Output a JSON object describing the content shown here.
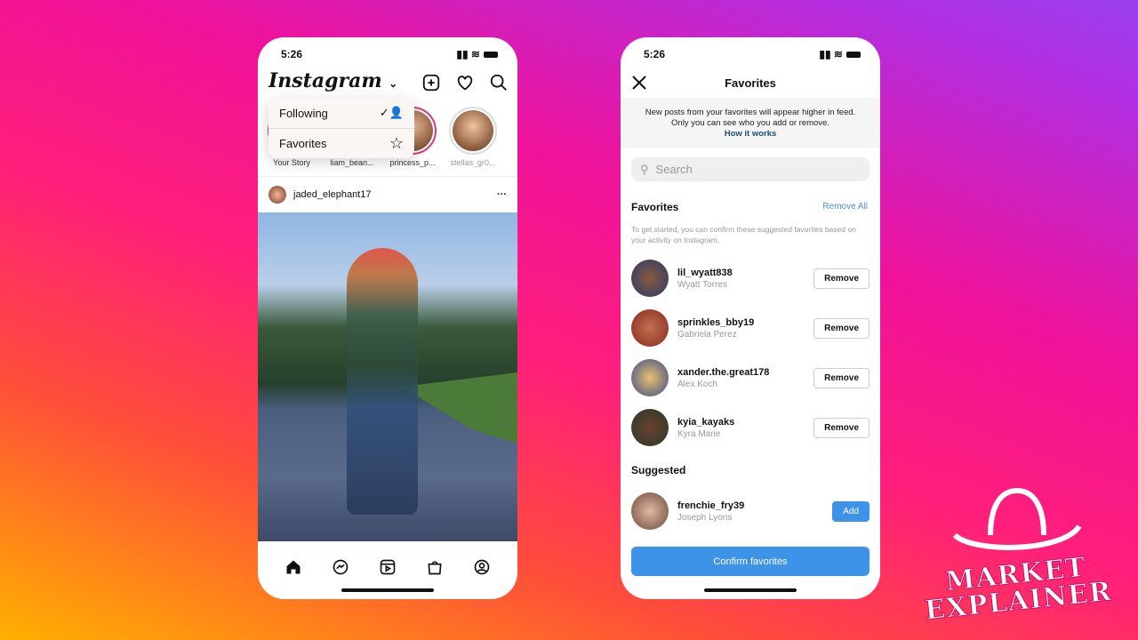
{
  "left_phone": {
    "time": "5:26",
    "app_logo": "Instagram",
    "dropdown": [
      {
        "label": "Following",
        "icon": "following-person-check-icon"
      },
      {
        "label": "Favorites",
        "icon": "star-icon"
      }
    ],
    "stories": [
      "Your Story",
      "liam_bean...",
      "princess_p...",
      "stellas_gr0..."
    ],
    "post": {
      "username": "jaded_elephant17",
      "more": "···"
    },
    "nav": [
      "home-icon",
      "messenger-icon",
      "reels-icon",
      "shop-icon",
      "profile-icon"
    ]
  },
  "right_phone": {
    "time": "5:26",
    "title": "Favorites",
    "info_line1": "New posts from your favorites will appear higher in feed.",
    "info_line2": "Only you can see who you add or remove.",
    "how_it_works": "How it works",
    "search_placeholder": "Search",
    "favorites_heading": "Favorites",
    "remove_all": "Remove All",
    "hint": "To get started, you can confirm these suggested favorites based on your activity on Instagram.",
    "favorites": [
      {
        "username": "lil_wyatt838",
        "name": "Wyatt Torres",
        "action": "Remove"
      },
      {
        "username": "sprinkles_bby19",
        "name": "Gabriela Perez",
        "action": "Remove"
      },
      {
        "username": "xander.the.great178",
        "name": "Alex Koch",
        "action": "Remove"
      },
      {
        "username": "kyia_kayaks",
        "name": "Kyra Marie",
        "action": "Remove"
      }
    ],
    "suggested_heading": "Suggested",
    "suggested": [
      {
        "username": "frenchie_fry39",
        "name": "Joseph Lyons",
        "action": "Add"
      }
    ],
    "confirm": "Confirm favorites"
  },
  "watermark": "MARKET EXPLAINER",
  "colors": {
    "accent": "#3d93e8",
    "link": "#4a8fd8"
  }
}
